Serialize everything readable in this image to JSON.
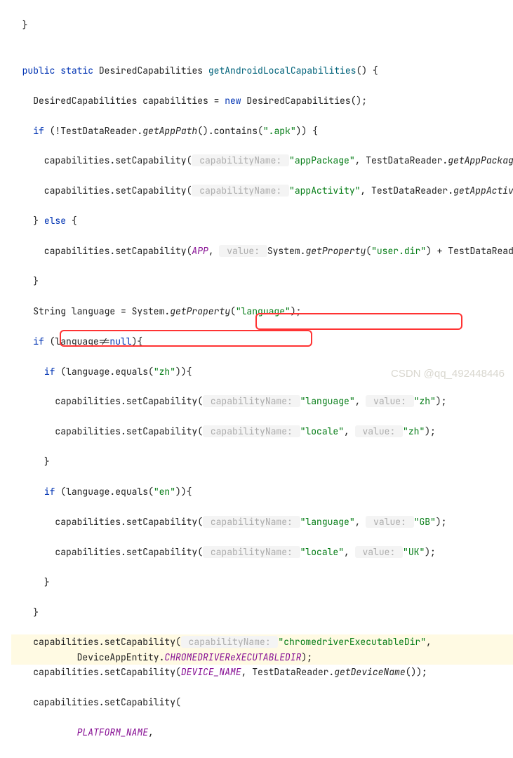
{
  "code": {
    "l0": "  }",
    "l1_pre": "  ",
    "l1_kw1": "public",
    "l1_kw2": "static",
    "l1_type": " DesiredCapabilities ",
    "l1_method": "getAndroidLocalCapabilities",
    "l1_post": "() {",
    "l2_a": "    DesiredCapabilities capabilities = ",
    "l2_kw": "new",
    "l2_b": " DesiredCapabilities();",
    "l3_a": "    ",
    "l3_kw": "if",
    "l3_b": " (!TestDataReader.",
    "l3_c": "getAppPath",
    "l3_d": "().contains(",
    "l3_str": "\".apk\"",
    "l3_e": ")) {",
    "l4_a": "      capabilities.setCapability(",
    "l4_hint": " capabilityName: ",
    "l4_str": "\"appPackage\"",
    "l4_b": ", TestDataReader.",
    "l4_c": "getAppPackage",
    "l4_d": "())",
    "l5_a": "      capabilities.setCapability(",
    "l5_hint": " capabilityName: ",
    "l5_str": "\"appActivity\"",
    "l5_b": ", TestDataReader.",
    "l5_c": "getAppActivity",
    "l5_d": "(",
    "l6_a": "    } ",
    "l6_kw": "else",
    "l6_b": " {",
    "l7_a": "      capabilities.setCapability(",
    "l7_const": "APP",
    "l7_b": ", ",
    "l7_hint": " value: ",
    "l7_c": "System.",
    "l7_m": "getProperty",
    "l7_d": "(",
    "l7_str": "\"user.dir\"",
    "l7_e": ") + TestDataReader.",
    "l8": "    }",
    "l9_a": "    String language = System.",
    "l9_m": "getProperty",
    "l9_b": "(",
    "l9_str": "\"language\"",
    "l9_c": ");",
    "l10_a": "    ",
    "l10_kw": "if",
    "l10_b": " (language!=",
    "l10_null": "null",
    "l10_c": "){",
    "l11_a": "      ",
    "l11_kw": "if",
    "l11_b": " (language.equals(",
    "l11_str": "\"zh\"",
    "l11_c": ")){",
    "l12_a": "        capabilities.setCapability(",
    "l12_h1": " capabilityName: ",
    "l12_s1": "\"language\"",
    "l12_b": ", ",
    "l12_h2": " value: ",
    "l12_s2": "\"zh\"",
    "l12_c": ");",
    "l13_a": "        capabilities.setCapability(",
    "l13_h1": " capabilityName: ",
    "l13_s1": "\"locale\"",
    "l13_b": ", ",
    "l13_h2": " value: ",
    "l13_s2": "\"zh\"",
    "l13_c": ");",
    "l14": "      }",
    "l15_a": "      ",
    "l15_kw": "if",
    "l15_b": " (language.equals(",
    "l15_str": "\"en\"",
    "l15_c": ")){",
    "l16_a": "        capabilities.setCapability(",
    "l16_h1": " capabilityName: ",
    "l16_s1": "\"language\"",
    "l16_b": ", ",
    "l16_h2": " value: ",
    "l16_s2": "\"GB\"",
    "l16_c": ");",
    "l17_a": "        capabilities.setCapability(",
    "l17_h1": " capabilityName: ",
    "l17_s1": "\"locale\"",
    "l17_b": ", ",
    "l17_h2": " value: ",
    "l17_s2": "\"UK\"",
    "l17_c": ");",
    "l18": "      }",
    "l19": "    }",
    "l20_a": "    capabilities.setCapability(",
    "l20_h1": " capabilityName: ",
    "l20_s1": "\"chromedriverExecutableDir\"",
    "l20_b": ",",
    "l21_a": "            DeviceAppEntity.",
    "l21_const": "CHROMEDRIVEReXECUTABLEDIR",
    "l21_b": ");",
    "l22_a": "    capabilities.setCapability(",
    "l22_const": "DEVICE_NAME",
    "l22_b": ", TestDataReader.",
    "l22_m": "getDeviceName",
    "l22_c": "());",
    "l23": "    capabilities.setCapability(",
    "l24_a": "            ",
    "l24_const": "PLATFORM_NAME",
    "l24_b": ","
  },
  "watermark": "CSDN @qq_492448446"
}
